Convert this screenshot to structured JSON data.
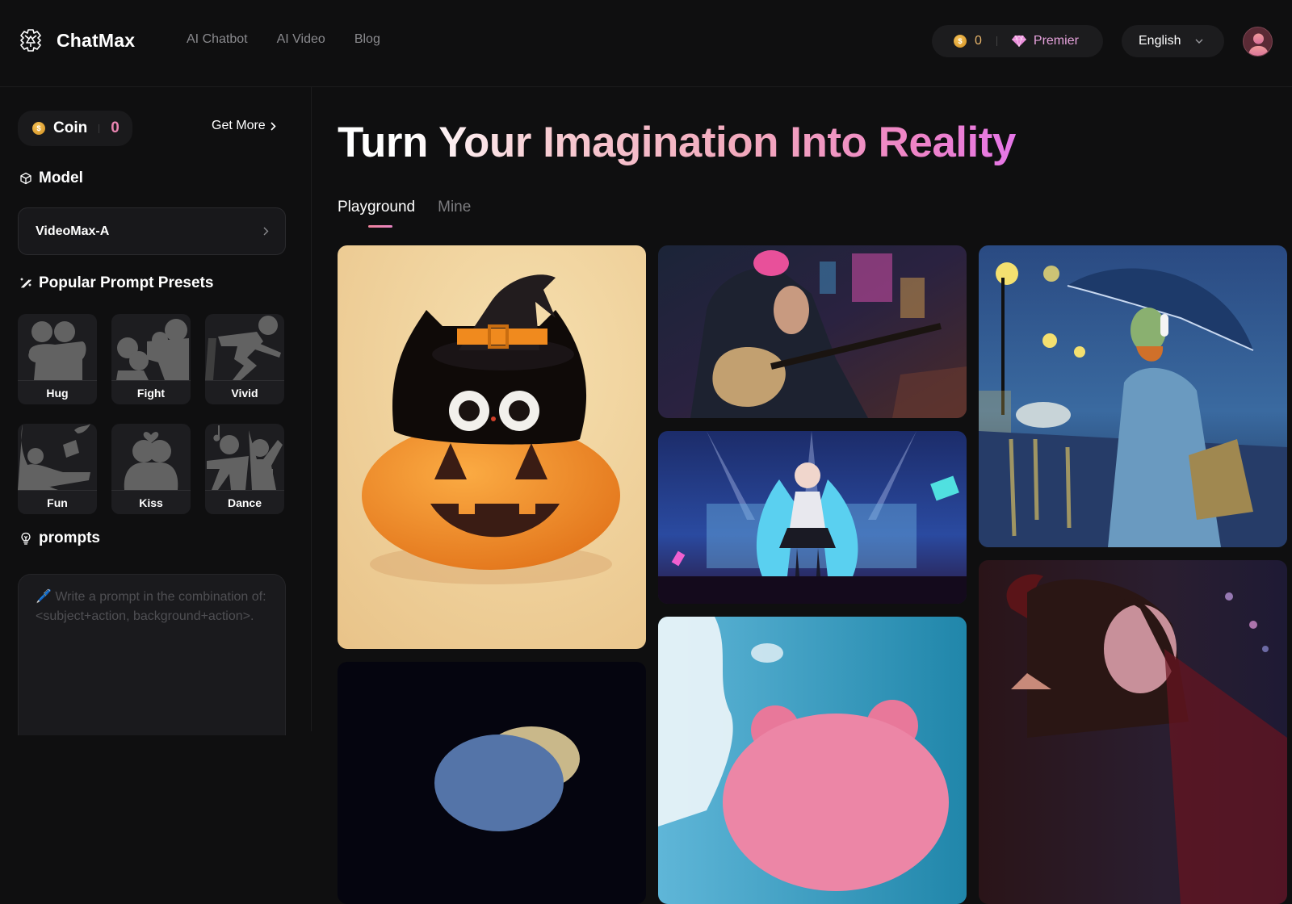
{
  "header": {
    "logo_icon": "chatmax-logo-icon",
    "brand": "ChatMax",
    "nav": [
      {
        "label": "AI Chatbot"
      },
      {
        "label": "AI Video"
      },
      {
        "label": "Blog"
      }
    ],
    "coin_icon": "coin-icon",
    "coin_balance": "0",
    "premier_icon": "diamond-icon",
    "premier_label": "Premier",
    "language": "English",
    "language_icon": "chevron-down-icon",
    "avatar_icon": "user-avatar-icon"
  },
  "sidebar": {
    "coin": {
      "label": "Coin",
      "value": "0",
      "get_more": "Get More"
    },
    "model": {
      "title": "Model",
      "icon": "cube-icon",
      "selected": "VideoMax-A"
    },
    "presets": {
      "title": "Popular Prompt Presets",
      "icon": "magic-wand-icon",
      "items": [
        {
          "label": "Hug",
          "icon": "hug-icon"
        },
        {
          "label": "Fight",
          "icon": "fight-icon"
        },
        {
          "label": "Vivid",
          "icon": "vivid-icon"
        },
        {
          "label": "Fun",
          "icon": "fun-icon"
        },
        {
          "label": "Kiss",
          "icon": "kiss-icon"
        },
        {
          "label": "Dance",
          "icon": "dance-icon"
        }
      ]
    },
    "prompts": {
      "title": "prompts",
      "icon": "lightbulb-icon",
      "value": "",
      "placeholder": "🖊️ Write a prompt in the combination of: <subject+action, background+action>."
    }
  },
  "main": {
    "hero": "Turn Your Imagination Into Reality",
    "tabs": [
      {
        "label": "Playground",
        "active": true
      },
      {
        "label": "Mine",
        "active": false
      }
    ],
    "gallery": [
      {
        "subject": "Black cat in witch hat on a pumpkin"
      },
      {
        "subject": "Anime girl playing guitar in rainy neon city"
      },
      {
        "subject": "Blue-haired idol singing at concert"
      },
      {
        "subject": "Van Gogh style man with umbrella in rain"
      },
      {
        "subject": "Girl with a pearl earring style painting"
      },
      {
        "subject": "Pink fluffy bear against blue sky"
      },
      {
        "subject": "Demon girl with horns in dark city"
      }
    ]
  },
  "colors": {
    "background": "#0f0f10",
    "panel": "#1c1c1e",
    "accent_pink": "#e884b0",
    "premier": "#e6a2dc",
    "coin_gold": "#e7b46a"
  }
}
